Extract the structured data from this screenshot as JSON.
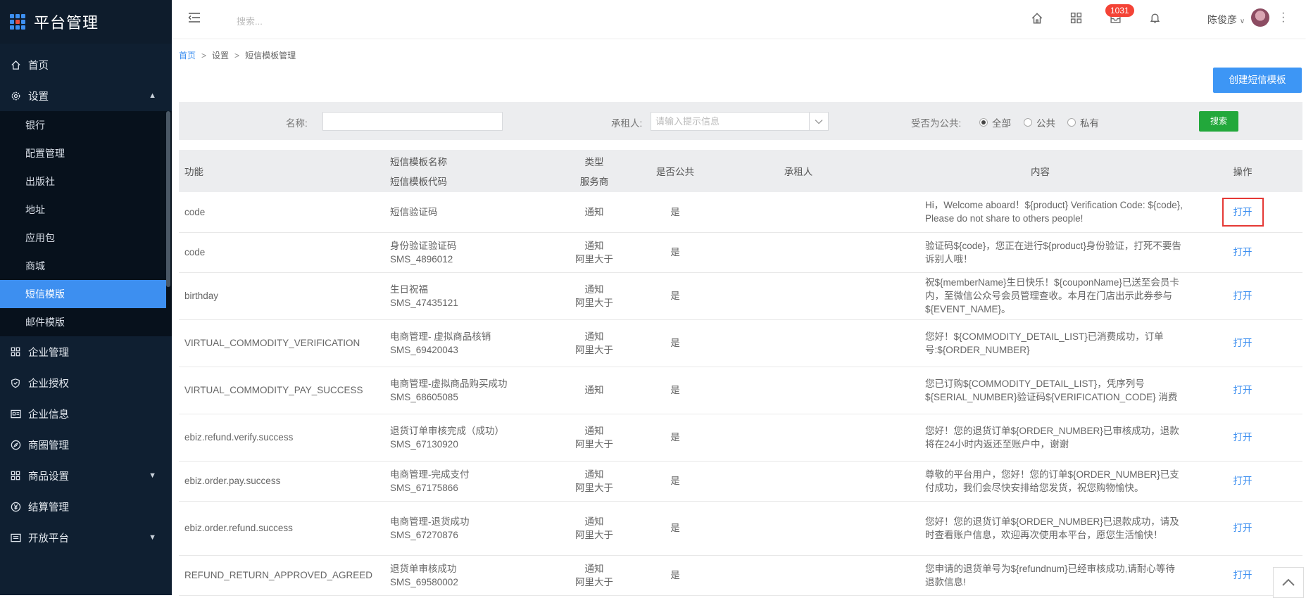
{
  "app": {
    "title": "平台管理"
  },
  "sidebar": {
    "items": [
      {
        "label": "首页",
        "icon": "home-icon"
      },
      {
        "label": "设置",
        "icon": "gear-icon",
        "expanded": true
      },
      {
        "label": "企业管理",
        "icon": "grid-icon"
      },
      {
        "label": "企业授权",
        "icon": "shield-icon"
      },
      {
        "label": "企业信息",
        "icon": "id-card-icon"
      },
      {
        "label": "商圈管理",
        "icon": "compass-icon"
      },
      {
        "label": "商品设置",
        "icon": "grid-icon"
      },
      {
        "label": "结算管理",
        "icon": "yen-icon"
      },
      {
        "label": "开放平台",
        "icon": "list-icon"
      }
    ],
    "settings_sub": [
      "银行",
      "配置管理",
      "出版社",
      "地址",
      "应用包",
      "商城",
      "短信模版",
      "邮件模版"
    ],
    "active_sub": "短信模版"
  },
  "header": {
    "search_placeholder": "搜索...",
    "notification_count": "1031",
    "user_name": "陈俊彦"
  },
  "breadcrumb": {
    "home": "首页",
    "level2": "设置",
    "current": "短信模板管理",
    "separator": ">"
  },
  "actions": {
    "create_label": "创建短信模板"
  },
  "filter": {
    "name_label": "名称:",
    "tenant_label": "承租人:",
    "tenant_placeholder": "请输入提示信息",
    "public_label": "受否为公共:",
    "radio_all": "全部",
    "radio_public": "公共",
    "radio_private": "私有",
    "selected": "全部",
    "search_label": "搜索"
  },
  "table": {
    "headers": {
      "func": "功能",
      "name": "短信模板名称",
      "code": "短信模板代码",
      "type": "类型",
      "provider": "服务商",
      "public": "是否公共",
      "tenant": "承租人",
      "content": "内容",
      "action": "操作"
    },
    "rows": [
      {
        "func": "code",
        "name": "短信验证码",
        "code": "",
        "type": "通知",
        "provider": "",
        "public": "是",
        "tenant": "",
        "content": "Hi，Welcome aboard！${product} Verification Code: ${code}, Please do not share to others people!",
        "action": "打开"
      },
      {
        "func": "code",
        "name": "身份验证验证码",
        "code": "SMS_4896012",
        "type": "通知",
        "provider": "阿里大于",
        "public": "是",
        "tenant": "",
        "content": "验证码${code}，您正在进行${product}身份验证，打死不要告诉别人哦！",
        "action": "打开"
      },
      {
        "func": "birthday",
        "name": "生日祝福",
        "code": "SMS_47435121",
        "type": "通知",
        "provider": "阿里大于",
        "public": "是",
        "tenant": "",
        "content": "祝${memberName}生日快乐！${couponName}已送至会员卡内，至微信公众号会员管理查收。本月在门店出示此券参与${EVENT_NAME}。",
        "action": "打开"
      },
      {
        "func": "VIRTUAL_COMMODITY_VERIFICATION",
        "name": "电商管理- 虚拟商品核销",
        "code": "SMS_69420043",
        "type": "通知",
        "provider": "阿里大于",
        "public": "是",
        "tenant": "",
        "content": "您好！${COMMODITY_DETAIL_LIST}已消费成功，订单号:${ORDER_NUMBER}",
        "action": "打开"
      },
      {
        "func": "VIRTUAL_COMMODITY_PAY_SUCCESS",
        "name": "电商管理-虚拟商品购买成功",
        "code": "SMS_68605085",
        "type": "通知",
        "provider": "",
        "public": "是",
        "tenant": "",
        "content": "您已订购${COMMODITY_DETAIL_LIST}，凭序列号${SERIAL_NUMBER}验证码${VERIFICATION_CODE} 消费",
        "action": "打开"
      },
      {
        "func": "ebiz.refund.verify.success",
        "name": "退货订单审核完成（成功）",
        "code": "SMS_67130920",
        "type": "通知",
        "provider": "阿里大于",
        "public": "是",
        "tenant": "",
        "content": "您好！您的退货订单${ORDER_NUMBER}已审核成功，退款将在24小时内返还至账户中，谢谢",
        "action": "打开"
      },
      {
        "func": "ebiz.order.pay.success",
        "name": "电商管理-完成支付",
        "code": "SMS_67175866",
        "type": "通知",
        "provider": "阿里大于",
        "public": "是",
        "tenant": "",
        "content": "尊敬的平台用户，您好！您的订单${ORDER_NUMBER}已支付成功，我们会尽快安排给您发货，祝您购物愉快。",
        "action": "打开"
      },
      {
        "func": "ebiz.order.refund.success",
        "name": "电商管理-退货成功",
        "code": "SMS_67270876",
        "type": "通知",
        "provider": "阿里大于",
        "public": "是",
        "tenant": "",
        "content": "您好！您的退货订单${ORDER_NUMBER}已退款成功，请及时查看账户信息，欢迎再次使用本平台，愿您生活愉快！",
        "action": "打开"
      },
      {
        "func": "REFUND_RETURN_APPROVED_AGREED",
        "name": "退货单审核成功",
        "code": "SMS_69580002",
        "type": "通知",
        "provider": "阿里大于",
        "public": "是",
        "tenant": "",
        "content": "您申请的退货单号为${refundnum}已经审核成功,请耐心等待退款信息!",
        "action": "打开"
      }
    ]
  },
  "colors": {
    "sidebar_bg": "#0f1f31",
    "accent": "#3d8ff0",
    "search_green": "#22a83b",
    "badge_red": "#f44336",
    "highlight_red": "#e53935"
  }
}
